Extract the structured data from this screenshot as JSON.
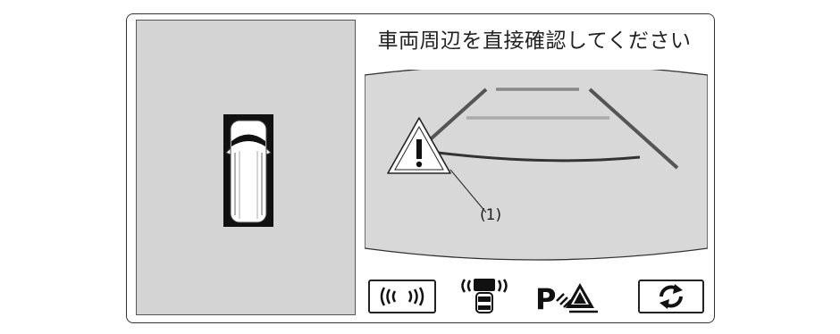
{
  "warning": {
    "message": "車両周辺を直接確認してください"
  },
  "camera_view": {
    "callout_label": "(1)",
    "warning_icon": "exclamation-triangle-icon"
  },
  "top_view": {
    "vehicle_icon": "vehicle-top-view-icon"
  },
  "buttons": {
    "sonar_icon": "sonar-wave-icon",
    "sensor_icon": "vehicle-sensor-icon",
    "park_icon": "parking-assist-icon",
    "park_text": "P",
    "rotate_icon": "camera-switch-rotate-icon"
  },
  "colors": {
    "panel_background": "#d4d4d4",
    "camera_background": "#d8d8d8",
    "outline": "#222222"
  }
}
